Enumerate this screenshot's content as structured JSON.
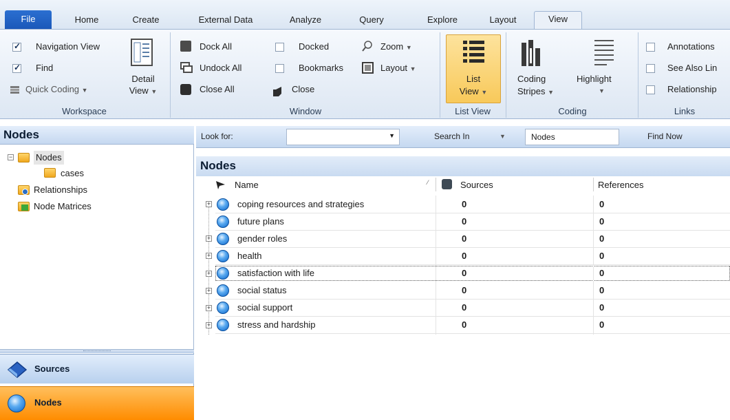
{
  "tabs": [
    "File",
    "Home",
    "Create",
    "External Data",
    "Analyze",
    "Query",
    "Explore",
    "Layout",
    "View"
  ],
  "ribbon": {
    "workspace": {
      "navigation_view": "Navigation View",
      "find": "Find",
      "quick_coding": "Quick Coding",
      "detail_view_line1": "Detail",
      "detail_view_line2": "View",
      "label": "Workspace"
    },
    "window": {
      "dock_all": "Dock All",
      "undock_all": "Undock All",
      "close_all": "Close All",
      "docked": "Docked",
      "bookmarks": "Bookmarks",
      "close": "Close",
      "zoom": "Zoom",
      "layout": "Layout",
      "label": "Window"
    },
    "list_view": {
      "line1": "List",
      "line2": "View",
      "label": "List View"
    },
    "coding": {
      "coding_stripes_line1": "Coding",
      "coding_stripes_line2": "Stripes",
      "highlight": "Highlight",
      "label": "Coding"
    },
    "links": {
      "annotations": "Annotations",
      "see_also": "See Also Lin",
      "relationships": "Relationship",
      "label": "Links"
    }
  },
  "left_panel": {
    "title": "Nodes",
    "tree": [
      "Nodes",
      "cases",
      "Relationships",
      "Node Matrices"
    ],
    "nav_sources": "Sources",
    "nav_nodes": "Nodes"
  },
  "find_bar": {
    "look_for": "Look for:",
    "search_in": "Search In",
    "search_in_value": "Nodes",
    "find_now": "Find Now"
  },
  "content": {
    "title": "Nodes",
    "columns": {
      "name": "Name",
      "sources": "Sources",
      "references": "References"
    },
    "rows": [
      {
        "name": "coping resources and strategies",
        "sources": "0",
        "references": "0"
      },
      {
        "name": "future plans",
        "sources": "0",
        "references": "0"
      },
      {
        "name": "gender roles",
        "sources": "0",
        "references": "0"
      },
      {
        "name": "health",
        "sources": "0",
        "references": "0"
      },
      {
        "name": "satisfaction with life",
        "sources": "0",
        "references": "0"
      },
      {
        "name": "social status",
        "sources": "0",
        "references": "0"
      },
      {
        "name": "social support",
        "sources": "0",
        "references": "0"
      },
      {
        "name": "stress and hardship",
        "sources": "0",
        "references": "0"
      }
    ]
  },
  "colors": {
    "accent": "#1a57b8",
    "selected_nav": "#ff8c00",
    "ribbon_bg": "#dde7f3"
  },
  "icons": [
    "nodes-folder-icon",
    "relationships-icon",
    "node-matrices-icon",
    "sources-icon",
    "node-icon",
    "list-view-icon",
    "detail-view-icon",
    "coding-stripes-icon",
    "highlight-icon",
    "zoom-icon"
  ]
}
